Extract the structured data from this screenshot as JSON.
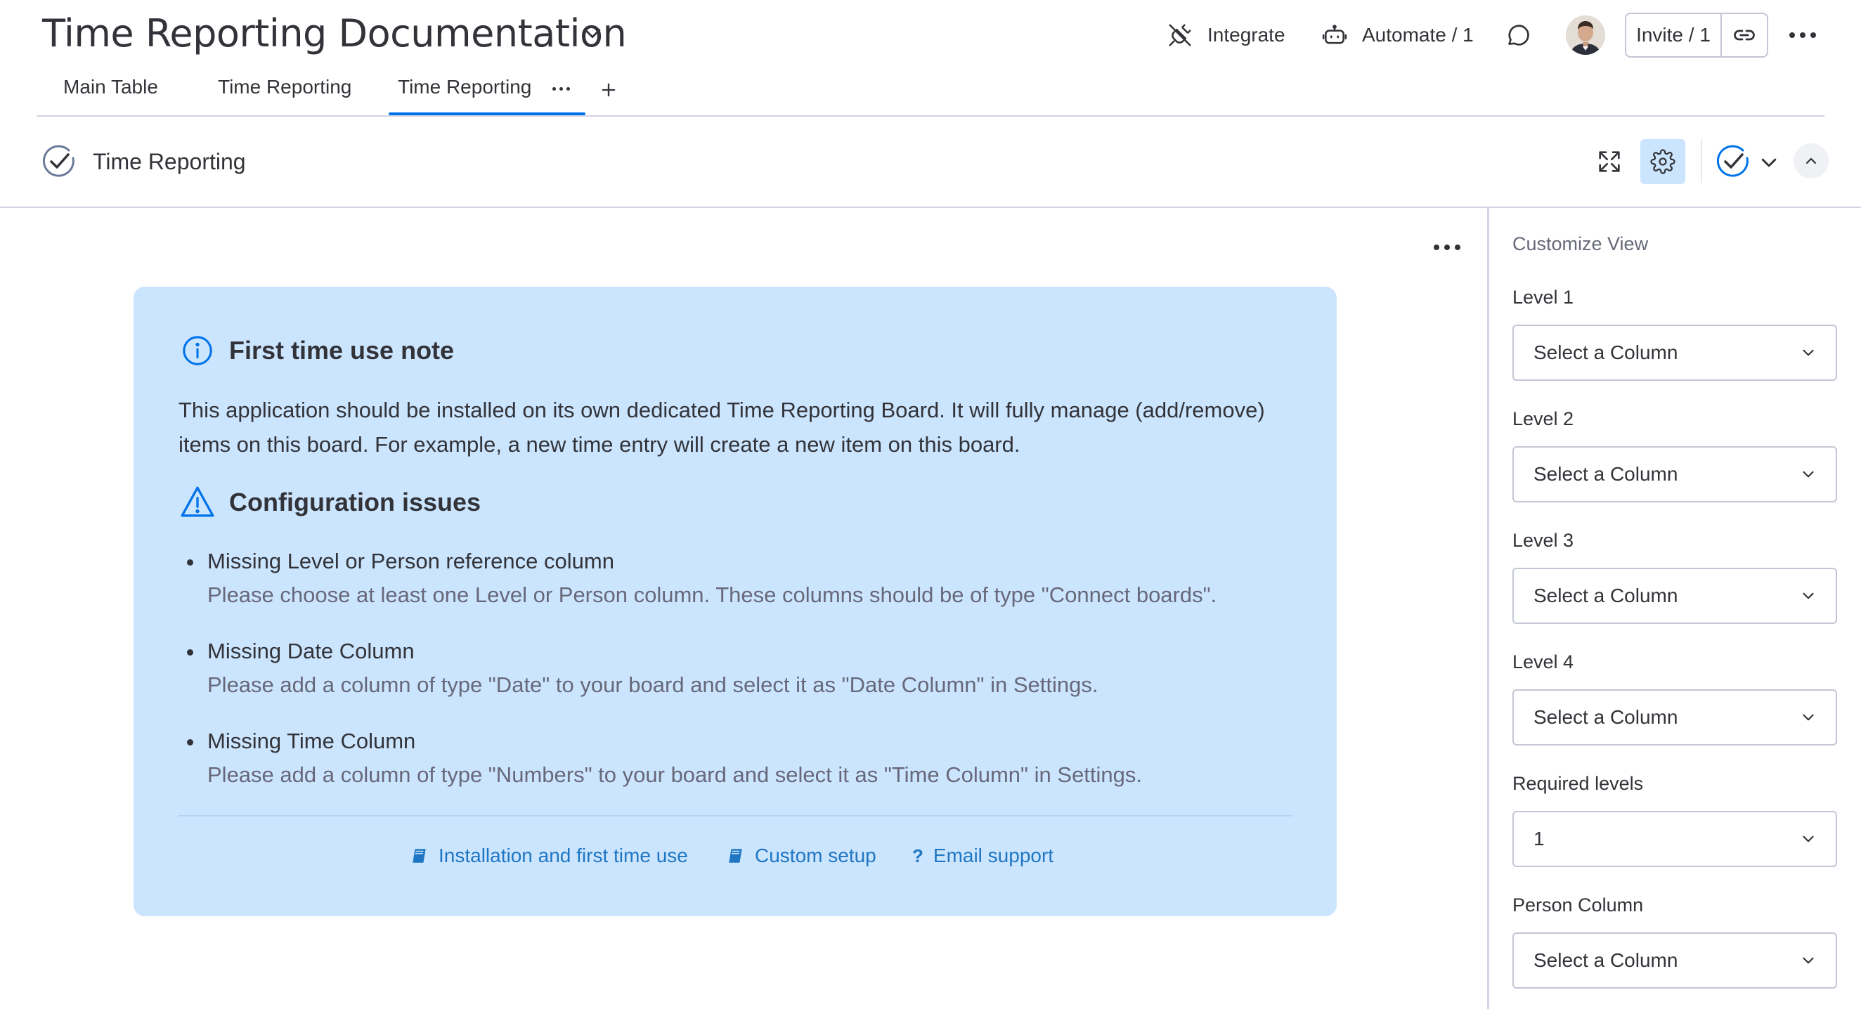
{
  "header": {
    "board_title": "Time Reporting Documentation",
    "integrate_label": "Integrate",
    "automate_label": "Automate / 1",
    "invite_label": "Invite / 1"
  },
  "tabs": [
    {
      "label": "Main Table"
    },
    {
      "label": "Time Reporting"
    },
    {
      "label": "Time Reporting",
      "active": true
    }
  ],
  "view": {
    "title": "Time Reporting"
  },
  "note": {
    "heading": "First time use note",
    "body": "This application should be installed on its own dedicated Time Reporting Board. It will fully manage (add/remove) items on this board. For example, a new time entry will create a new item on this board.",
    "config_heading": "Configuration issues",
    "issues": [
      {
        "title": "Missing Level or Person reference column",
        "description": "Please choose at least one Level or Person column. These columns should be of type \"Connect boards\"."
      },
      {
        "title": "Missing Date Column",
        "description": "Please add a column of type \"Date\" to your board and select it as \"Date Column\" in Settings."
      },
      {
        "title": "Missing Time Column",
        "description": "Please add a column of type \"Numbers\" to your board and select it as \"Time Column\" in Settings."
      }
    ],
    "links": [
      {
        "label": "Installation and first time use",
        "icon": "book-icon"
      },
      {
        "label": "Custom setup",
        "icon": "book-icon"
      },
      {
        "label": "Email support",
        "icon": "question-icon"
      }
    ]
  },
  "panel": {
    "title": "Customize View",
    "fields": [
      {
        "label": "Level 1",
        "value": "Select a Column"
      },
      {
        "label": "Level 2",
        "value": "Select a Column"
      },
      {
        "label": "Level 3",
        "value": "Select a Column"
      },
      {
        "label": "Level 4",
        "value": "Select a Column"
      },
      {
        "label": "Required levels",
        "value": "1"
      },
      {
        "label": "Person Column",
        "value": "Select a Column"
      }
    ]
  },
  "colors": {
    "accent": "#0073ea",
    "note_background": "#cce5ff",
    "link": "#1f76c2",
    "border": "#d0d4e4"
  }
}
